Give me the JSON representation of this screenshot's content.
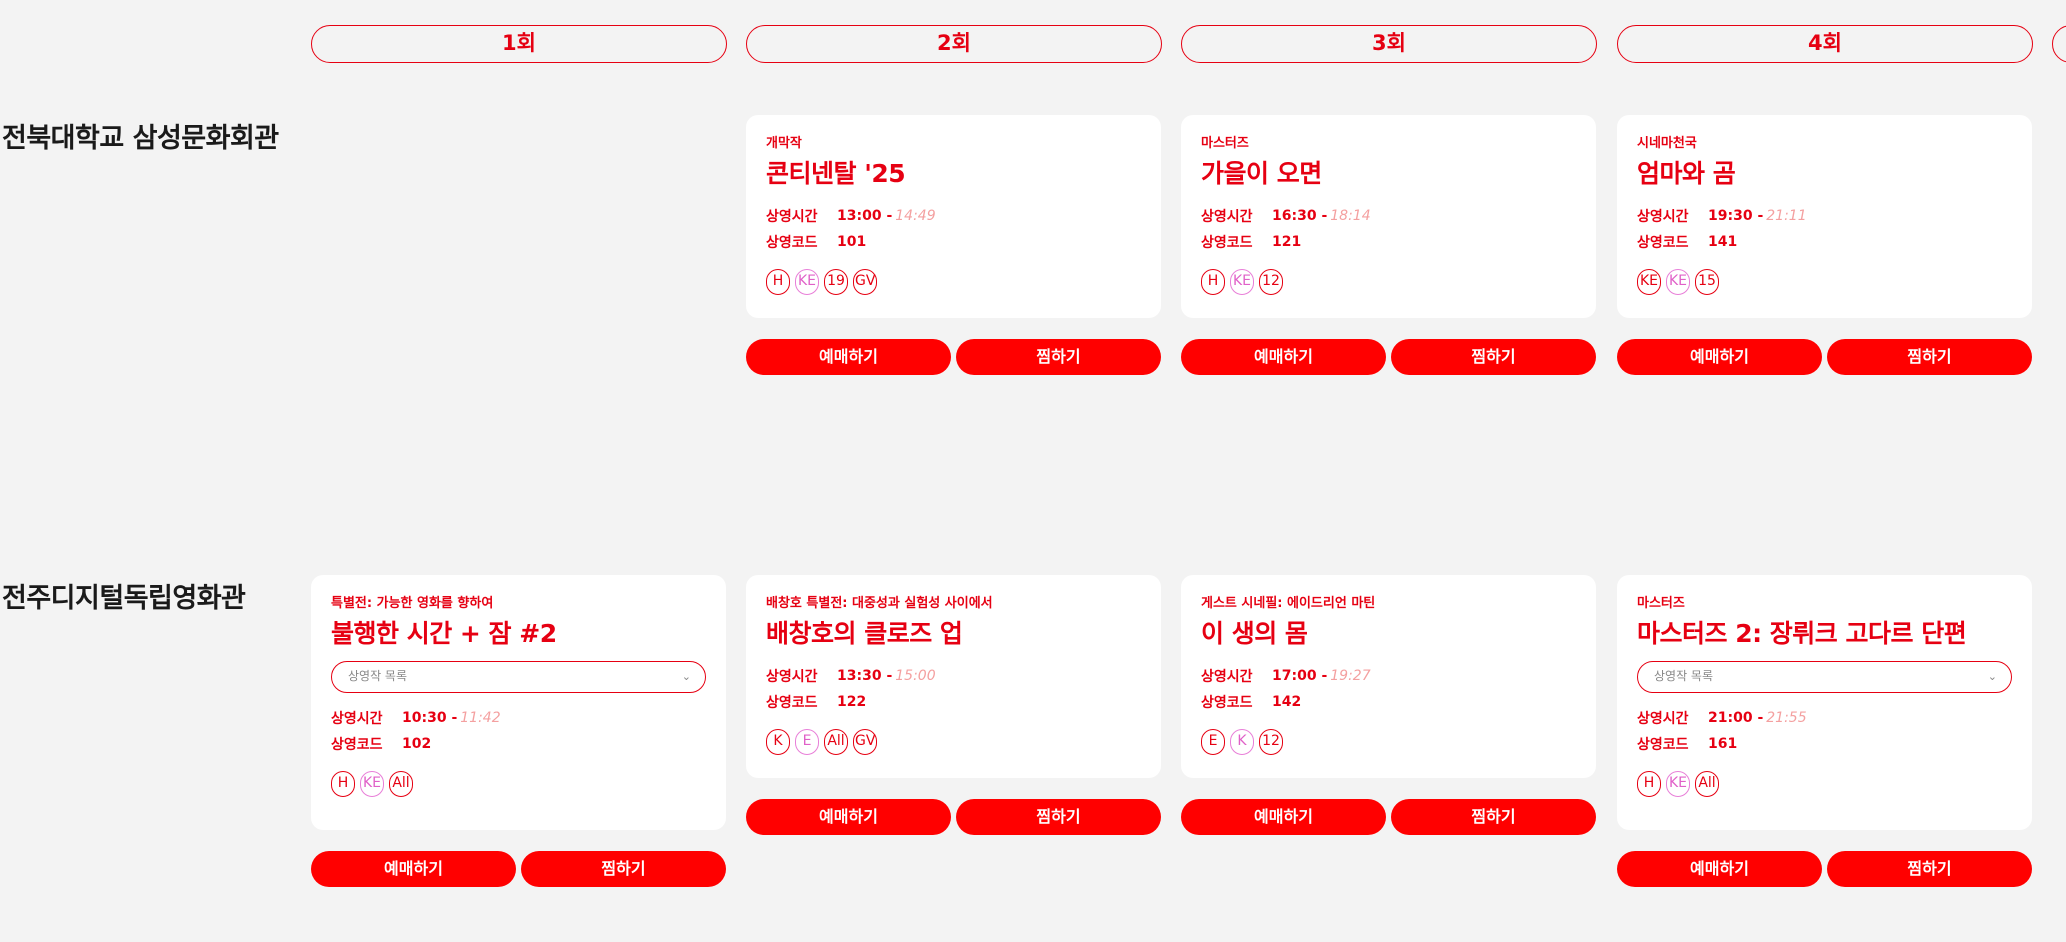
{
  "rounds": [
    {
      "label": "1회"
    },
    {
      "label": "2회"
    },
    {
      "label": "3회"
    },
    {
      "label": "4회"
    }
  ],
  "venues": [
    {
      "name": "전북대학교 삼성문화회관"
    },
    {
      "name": "전주디지털독립영화관"
    }
  ],
  "labels": {
    "time": "상영시간",
    "code": "상영코드",
    "reserve": "예매하기",
    "wish": "찜하기",
    "list_placeholder": "상영작 목록",
    "chevron": "⌄",
    "dash": "-"
  },
  "screenings": [
    {
      "category": "개막작",
      "title": "콘티넨탈 '25",
      "start": "13:00",
      "end": "14:49",
      "code": "101",
      "badges": [
        "H",
        "KE",
        "19",
        "GV"
      ]
    },
    {
      "category": "마스터즈",
      "title": "가을이 오면",
      "start": "16:30",
      "end": "18:14",
      "code": "121",
      "badges": [
        "H",
        "KE",
        "12"
      ]
    },
    {
      "category": "시네마천국",
      "title": "엄마와 곰",
      "start": "19:30",
      "end": "21:11",
      "code": "141",
      "badges": [
        "KE",
        "KE",
        "15"
      ]
    },
    {
      "category": "특별전: 가능한 영화를 향하여",
      "title": "불행한 시간 + 잠 #2",
      "start": "10:30",
      "end": "11:42",
      "code": "102",
      "badges": [
        "H",
        "KE",
        "All"
      ]
    },
    {
      "category": "배창호 특별전: 대중성과 실험성 사이에서",
      "title": "배창호의 클로즈 업",
      "start": "13:30",
      "end": "15:00",
      "code": "122",
      "badges": [
        "K",
        "E",
        "All",
        "GV"
      ]
    },
    {
      "category": "게스트 시네필: 에이드리언 마틴",
      "title": "이 생의 몸",
      "start": "17:00",
      "end": "19:27",
      "code": "142",
      "badges": [
        "E",
        "K",
        "12"
      ]
    },
    {
      "category": "마스터즈",
      "title": "마스터즈 2: 장뤼크 고다르 단편",
      "start": "21:00",
      "end": "21:55",
      "code": "161",
      "badges": [
        "H",
        "KE",
        "All"
      ]
    }
  ]
}
